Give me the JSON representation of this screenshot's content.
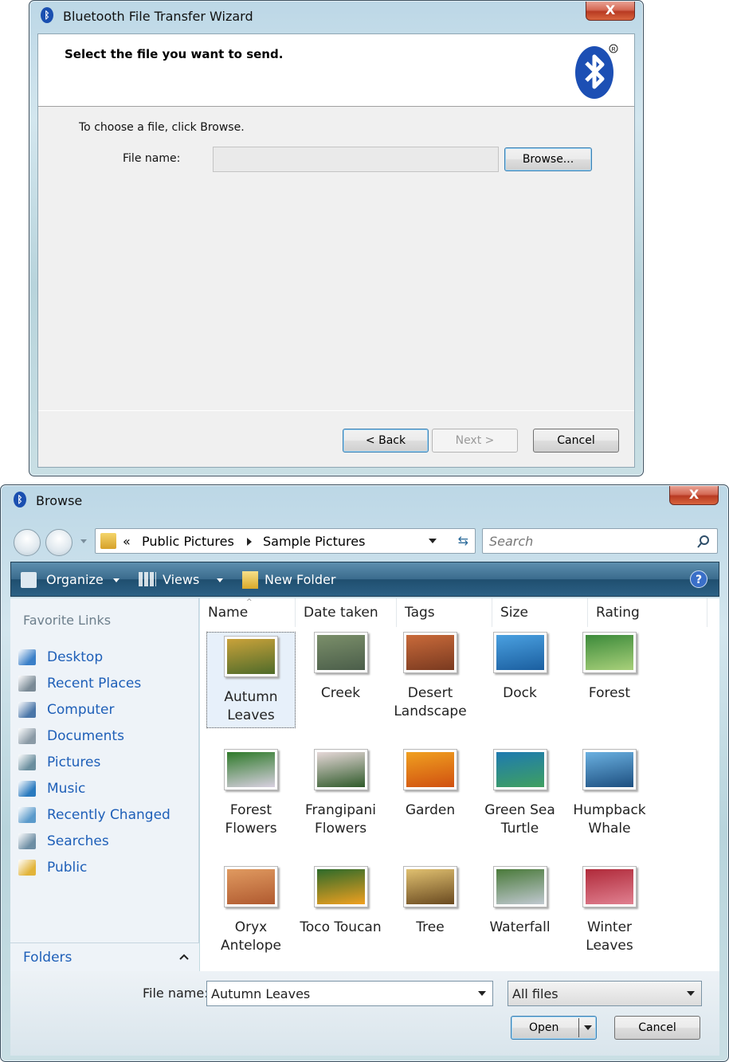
{
  "wizard": {
    "title": "Bluetooth File Transfer Wizard",
    "heading": "Select the file you want to send.",
    "instruction": "To choose a file, click Browse.",
    "file_label": "File name:",
    "file_value": "",
    "browse_label": "Browse...",
    "back_label": "< Back",
    "next_label": "Next >",
    "cancel_label": "Cancel",
    "close_label": "X"
  },
  "browse": {
    "title": "Browse",
    "close_label": "X",
    "breadcrumb_prefix": "«",
    "breadcrumb": [
      "Public Pictures",
      "Sample Pictures"
    ],
    "search_placeholder": "Search",
    "toolbar": {
      "organize": "Organize",
      "views": "Views",
      "new_folder": "New Folder",
      "help": "?"
    },
    "favorite_title": "Favorite Links",
    "links": [
      {
        "label": "Desktop",
        "icon": "desktop-icon",
        "color": "#3a7fc8"
      },
      {
        "label": "Recent Places",
        "icon": "recent-places-icon",
        "color": "#7a8a96"
      },
      {
        "label": "Computer",
        "icon": "computer-icon",
        "color": "#4a76a8"
      },
      {
        "label": "Documents",
        "icon": "documents-icon",
        "color": "#8a9aa6"
      },
      {
        "label": "Pictures",
        "icon": "pictures-icon",
        "color": "#6a8e9e"
      },
      {
        "label": "Music",
        "icon": "music-icon",
        "color": "#2a7abf"
      },
      {
        "label": "Recently Changed",
        "icon": "recently-changed-icon",
        "color": "#5a9acb"
      },
      {
        "label": "Searches",
        "icon": "searches-icon",
        "color": "#6d8ea4"
      },
      {
        "label": "Public",
        "icon": "public-folder-icon",
        "color": "#e2b43a"
      }
    ],
    "folders_label": "Folders",
    "columns": [
      "Name",
      "Date taken",
      "Tags",
      "Size",
      "Rating"
    ],
    "files": [
      {
        "lines": [
          "Autumn",
          "Leaves"
        ],
        "colors": [
          "#c9a23a",
          "#4f6b2a"
        ],
        "selected": true
      },
      {
        "lines": [
          "Creek"
        ],
        "colors": [
          "#7b8f6a",
          "#4b5e4a"
        ]
      },
      {
        "lines": [
          "Desert",
          "Landscape"
        ],
        "colors": [
          "#c96a3a",
          "#7a3a20"
        ]
      },
      {
        "lines": [
          "Dock"
        ],
        "colors": [
          "#4aa0e0",
          "#1b5fa0"
        ]
      },
      {
        "lines": [
          "Forest"
        ],
        "colors": [
          "#3c8a3a",
          "#a8d07a"
        ]
      },
      {
        "lines": [
          "Forest",
          "Flowers"
        ],
        "colors": [
          "#2f7a2a",
          "#d8d0e0"
        ]
      },
      {
        "lines": [
          "Frangipani",
          "Flowers"
        ],
        "colors": [
          "#e6d8d8",
          "#2f5a2a"
        ]
      },
      {
        "lines": [
          "Garden"
        ],
        "colors": [
          "#f0a020",
          "#d05010"
        ]
      },
      {
        "lines": [
          "Green Sea",
          "Turtle"
        ],
        "colors": [
          "#1e7ab0",
          "#3fa060"
        ]
      },
      {
        "lines": [
          "Humpback",
          "Whale"
        ],
        "colors": [
          "#6ab0e0",
          "#1d4f80"
        ]
      },
      {
        "lines": [
          "Oryx",
          "Antelope"
        ],
        "colors": [
          "#e09a60",
          "#b05a30"
        ]
      },
      {
        "lines": [
          "Toco Toucan"
        ],
        "colors": [
          "#2d6a2a",
          "#f0a020"
        ]
      },
      {
        "lines": [
          "Tree"
        ],
        "colors": [
          "#e0c070",
          "#6a4a20"
        ]
      },
      {
        "lines": [
          "Waterfall"
        ],
        "colors": [
          "#4a7a3a",
          "#c0c8d0"
        ]
      },
      {
        "lines": [
          "Winter",
          "Leaves"
        ],
        "colors": [
          "#b02a3a",
          "#e08090"
        ]
      }
    ],
    "file_name_label": "File name:",
    "file_name_value": "Autumn Leaves",
    "filter_value": "All files",
    "open_label": "Open",
    "cancel_label": "Cancel"
  }
}
